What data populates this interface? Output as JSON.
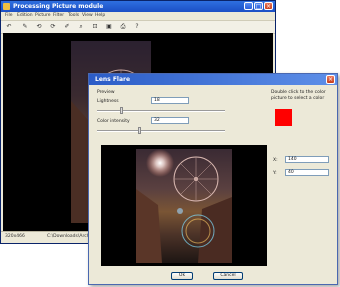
{
  "main_window": {
    "title": "Processing Picture module",
    "menu": [
      "File",
      "Edition",
      "Picture",
      "Filter",
      "Tools",
      "View",
      "Help"
    ],
    "toolbar_icons": [
      "undo-icon",
      "wand-icon",
      "rotate-left-icon",
      "rotate-right-icon",
      "brush-icon",
      "zoom-icon",
      "crop-icon",
      "save-icon",
      "print-icon",
      "help-icon"
    ],
    "status": {
      "size": "320x466",
      "path": "C:\\Downloads\\Archimos p"
    }
  },
  "dialog": {
    "title": "Lens Flare",
    "preview_label": "Preview",
    "lightness_label": "Lightness",
    "lightness_value": "18",
    "lightness_level": 0.18,
    "intensity_label": "Color intensity",
    "intensity_value": "32",
    "intensity_level": 0.32,
    "hint": "Double click to the color picture to select a color",
    "color": "#ff0000",
    "x_label": "X:",
    "x_value": "140",
    "y_label": "Y:",
    "y_value": "40",
    "ok_label": "Ok",
    "cancel_label": "Cancel"
  }
}
